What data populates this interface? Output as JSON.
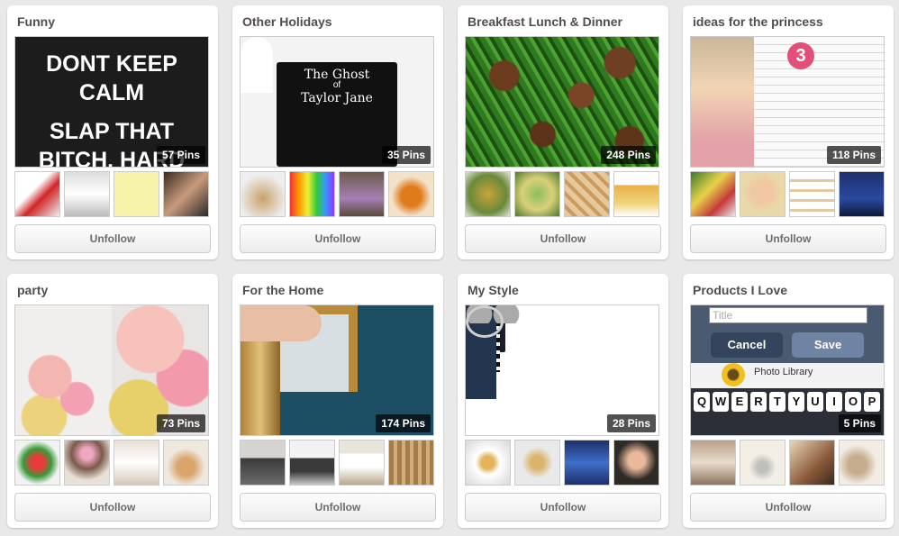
{
  "boards": [
    {
      "title": "Funny",
      "pin_count": "57 Pins",
      "cover_text": [
        "DONT KEEP",
        "CALM",
        "SLAP THAT",
        "BITCH. HARD"
      ],
      "button_label": "Unfollow"
    },
    {
      "title": "Other Holidays",
      "pin_count": "35 Pins",
      "cover_text": [
        "The Ghost",
        "of",
        "Taylor Jane"
      ],
      "button_label": "Unfollow"
    },
    {
      "title": "Breakfast Lunch & Dinner",
      "pin_count": "248 Pins",
      "button_label": "Unfollow"
    },
    {
      "title": "ideas for the princess",
      "pin_count": "118 Pins",
      "cover_text": [
        "3"
      ],
      "button_label": "Unfollow"
    },
    {
      "title": "party",
      "pin_count": "73 Pins",
      "button_label": "Unfollow"
    },
    {
      "title": "For the Home",
      "pin_count": "174 Pins",
      "button_label": "Unfollow"
    },
    {
      "title": "My Style",
      "pin_count": "28 Pins",
      "button_label": "Unfollow"
    },
    {
      "title": "Products I Love",
      "pin_count": "5 Pins",
      "cover_text": {
        "field_placeholder": "Title",
        "cancel": "Cancel",
        "save": "Save",
        "photo_library": "Photo Library",
        "keys": [
          "Q",
          "W",
          "E",
          "R",
          "T",
          "Y",
          "U",
          "I",
          "O",
          "P"
        ]
      },
      "button_label": "Unfollow"
    }
  ],
  "colors": {
    "page_background": "#e9e9e9",
    "card_background": "#ffffff",
    "title_text": "#524d4d",
    "button_text": "#6c6c6c",
    "badge_background": "rgba(0,0,0,0.68)"
  }
}
